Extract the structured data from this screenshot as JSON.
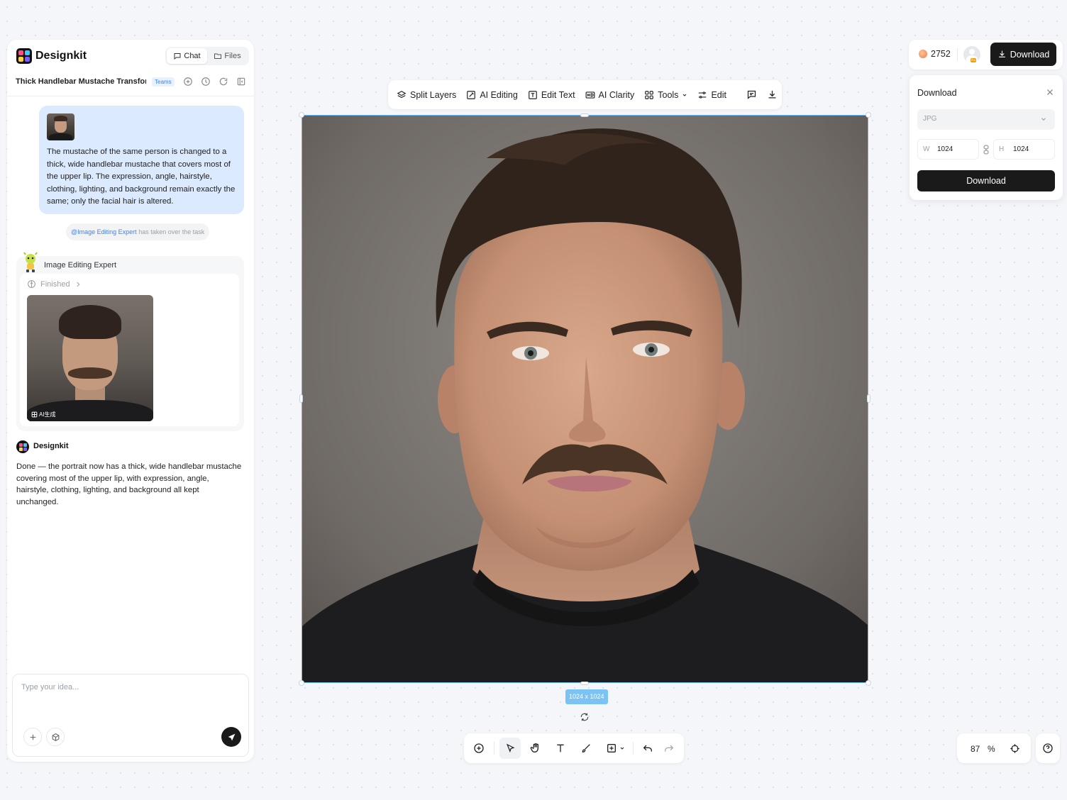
{
  "app": {
    "name": "Designkit",
    "logo_colors": [
      "#ff4d8d",
      "#3ec6ff",
      "#ffd23f",
      "#7c5cff"
    ]
  },
  "sidebar": {
    "tabs": [
      {
        "label": "Chat",
        "icon": "chat-bubble-icon",
        "active": true
      },
      {
        "label": "Files",
        "icon": "folder-icon",
        "active": false
      }
    ],
    "project_title": "Thick Handlebar Mustache Transfor...",
    "team_badge": "Teams",
    "header_icons": [
      "new-chat-icon",
      "history-icon",
      "refresh-icon",
      "collapse-panel-icon"
    ]
  },
  "chat": {
    "user_message": "The mustache of the same person is changed to a thick, wide handlebar mustache that covers most of the upper lip. The expression, angle, hairstyle, clothing, lighting, and background remain exactly the same; only the facial hair is altered.",
    "handoff": {
      "mention": "@Image Editing Expert",
      "text": "has taken over the task"
    },
    "expert": {
      "name": "Image Editing Expert",
      "status": "Finished",
      "image_tag": "AI生成"
    },
    "assistant": {
      "name": "Designkit",
      "message": "Done — the portrait now has a thick, wide handlebar mustache covering most of the upper lip, with expression, angle, hairstyle, clothing, lighting, and background all kept unchanged."
    },
    "input": {
      "placeholder": "Type your idea...",
      "value": ""
    }
  },
  "toolbar": {
    "items": [
      {
        "label": "Split Layers",
        "icon": "layers-icon"
      },
      {
        "label": "AI Editing",
        "icon": "ai-edit-icon"
      },
      {
        "label": "Edit Text",
        "icon": "text-box-icon"
      },
      {
        "label": "AI Clarity",
        "icon": "hd-icon"
      },
      {
        "label": "Tools",
        "icon": "grid-icon"
      },
      {
        "label": "Edit",
        "icon": "sliders-icon"
      }
    ],
    "extra_icons": [
      "comment-icon",
      "download-icon"
    ]
  },
  "canvas": {
    "size_label": "1024 x 1024",
    "selection_color": "#6cb4ee"
  },
  "bottom_toolbar": {
    "tools": [
      "add-icon",
      "select-pointer-icon",
      "hand-icon",
      "text-tool-icon",
      "brush-icon",
      "add-shape-icon",
      "undo-icon",
      "redo-icon"
    ],
    "active_tool": "select-pointer-icon"
  },
  "zoom": {
    "value": "87",
    "unit": "%"
  },
  "topbar": {
    "credits": "2752",
    "pro_badge": "Pro",
    "download_label": "Download"
  },
  "download_panel": {
    "title": "Download",
    "format": "JPG",
    "width_label": "W",
    "width": "1024",
    "height_label": "H",
    "height": "1024",
    "button_label": "Download"
  }
}
